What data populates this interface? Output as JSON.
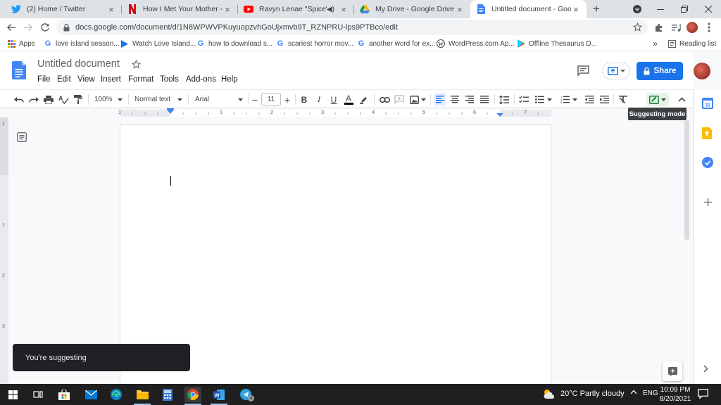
{
  "browser": {
    "tabs": [
      {
        "title": "(2) Home / Twitter",
        "icon": "twitter-icon"
      },
      {
        "title": "How I Met Your Mother - Play",
        "icon": "netflix-icon"
      },
      {
        "title": "Ravyn Lenae \"Spice\" [Sm",
        "icon": "youtube-icon"
      },
      {
        "title": "My Drive - Google Drive",
        "icon": "google-drive-icon"
      },
      {
        "title": "Untitled document - Google",
        "icon": "google-docs-icon",
        "active": true
      }
    ],
    "new_tab_label": "+",
    "url": "docs.google.com/document/d/1N8WPWVPKuyuopzvhGoUjxmvb9T_RZNPRU-lps9PTBco/edit",
    "bookmarks": [
      {
        "label": "Apps",
        "icon": "apps-grid-icon"
      },
      {
        "label": "love island season...",
        "icon": "google-icon"
      },
      {
        "label": "Watch Love Island...",
        "icon": "play-icon"
      },
      {
        "label": "how to download s...",
        "icon": "google-icon"
      },
      {
        "label": "scariest horror mov...",
        "icon": "google-icon"
      },
      {
        "label": "another word for ex...",
        "icon": "google-icon"
      },
      {
        "label": "WordPress.com Ap...",
        "icon": "wordpress-icon"
      },
      {
        "label": "Offline Thesaurus D...",
        "icon": "play-store-icon"
      }
    ],
    "overflow_label": "»",
    "reading_list_label": "Reading list"
  },
  "docs": {
    "title": "Untitled document",
    "menu": [
      "File",
      "Edit",
      "View",
      "Insert",
      "Format",
      "Tools",
      "Add-ons",
      "Help"
    ],
    "share_label": "Share",
    "toolbar": {
      "zoom": "100%",
      "style": "Normal text",
      "font": "Arial",
      "font_size": "11",
      "minus": "−",
      "plus": "+",
      "bold": "B",
      "italic": "I",
      "underline": "U",
      "text_color": "A"
    },
    "ruler_labels": [
      "1",
      "1",
      "2",
      "3",
      "4",
      "5",
      "6",
      "7"
    ],
    "vruler_labels": [
      "1",
      "1",
      "2",
      "3"
    ],
    "tooltip": "Suggesting mode",
    "toast": "You're suggesting"
  },
  "taskbar": {
    "weather": "20°C  Partly cloudy",
    "language": "ENG",
    "time": "10:09 PM",
    "date": "8/20/2021",
    "telegram_badge": "4"
  },
  "colors": {
    "accent": "#1a73e8",
    "docs_blue": "#4285f4",
    "taskbar": "#1f1f1f"
  }
}
